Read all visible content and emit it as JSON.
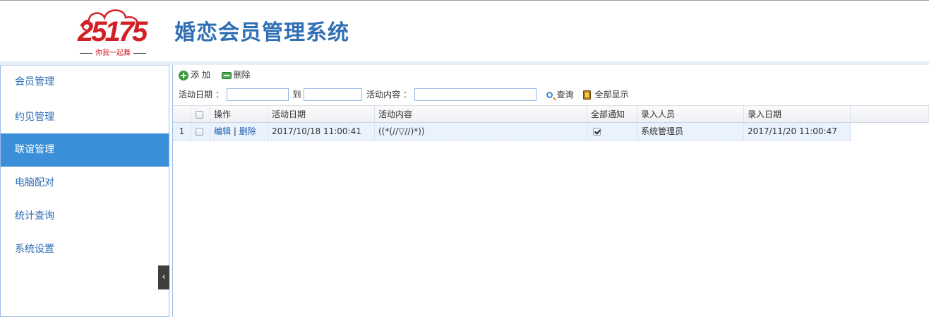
{
  "header": {
    "logo_number": "25175",
    "logo_slogan": "你我一起舞",
    "app_title": "婚恋会员管理系统"
  },
  "sidebar": {
    "items": [
      {
        "label": "会员管理"
      },
      {
        "label": "约见管理"
      },
      {
        "label": "联谊管理",
        "active": true
      },
      {
        "label": "电脑配对"
      },
      {
        "label": "统计查询"
      },
      {
        "label": "系统设置"
      }
    ],
    "collapse_glyph": "‹"
  },
  "toolbar": {
    "add_label": "添 加",
    "delete_label": "删除"
  },
  "search": {
    "date_label": "活动日期 ：",
    "to_label": "到",
    "content_label": "活动内容 ：",
    "date_from": "",
    "date_to": "",
    "content": "",
    "query_label": "查询",
    "show_all_label": "全部显示"
  },
  "grid": {
    "columns": [
      "操作",
      "活动日期",
      "活动内容",
      "全部通知",
      "录入人员",
      "录入日期"
    ],
    "rows": [
      {
        "num": "1",
        "edit": "编辑",
        "separator": "|",
        "delete": "删除",
        "date": "2017/10/18 11:00:41",
        "content": "((*(//▽//)*))",
        "notify_all": true,
        "user": "系统管理员",
        "entry_date": "2017/11/20 11:00:47"
      }
    ]
  },
  "colors": {
    "title_blue": "#2f6fb3",
    "nav_text": "#2a6cb6",
    "nav_active_bg": "#3b8fd9",
    "logo_red": "#d32027",
    "row_bg": "#eaf2fd"
  }
}
